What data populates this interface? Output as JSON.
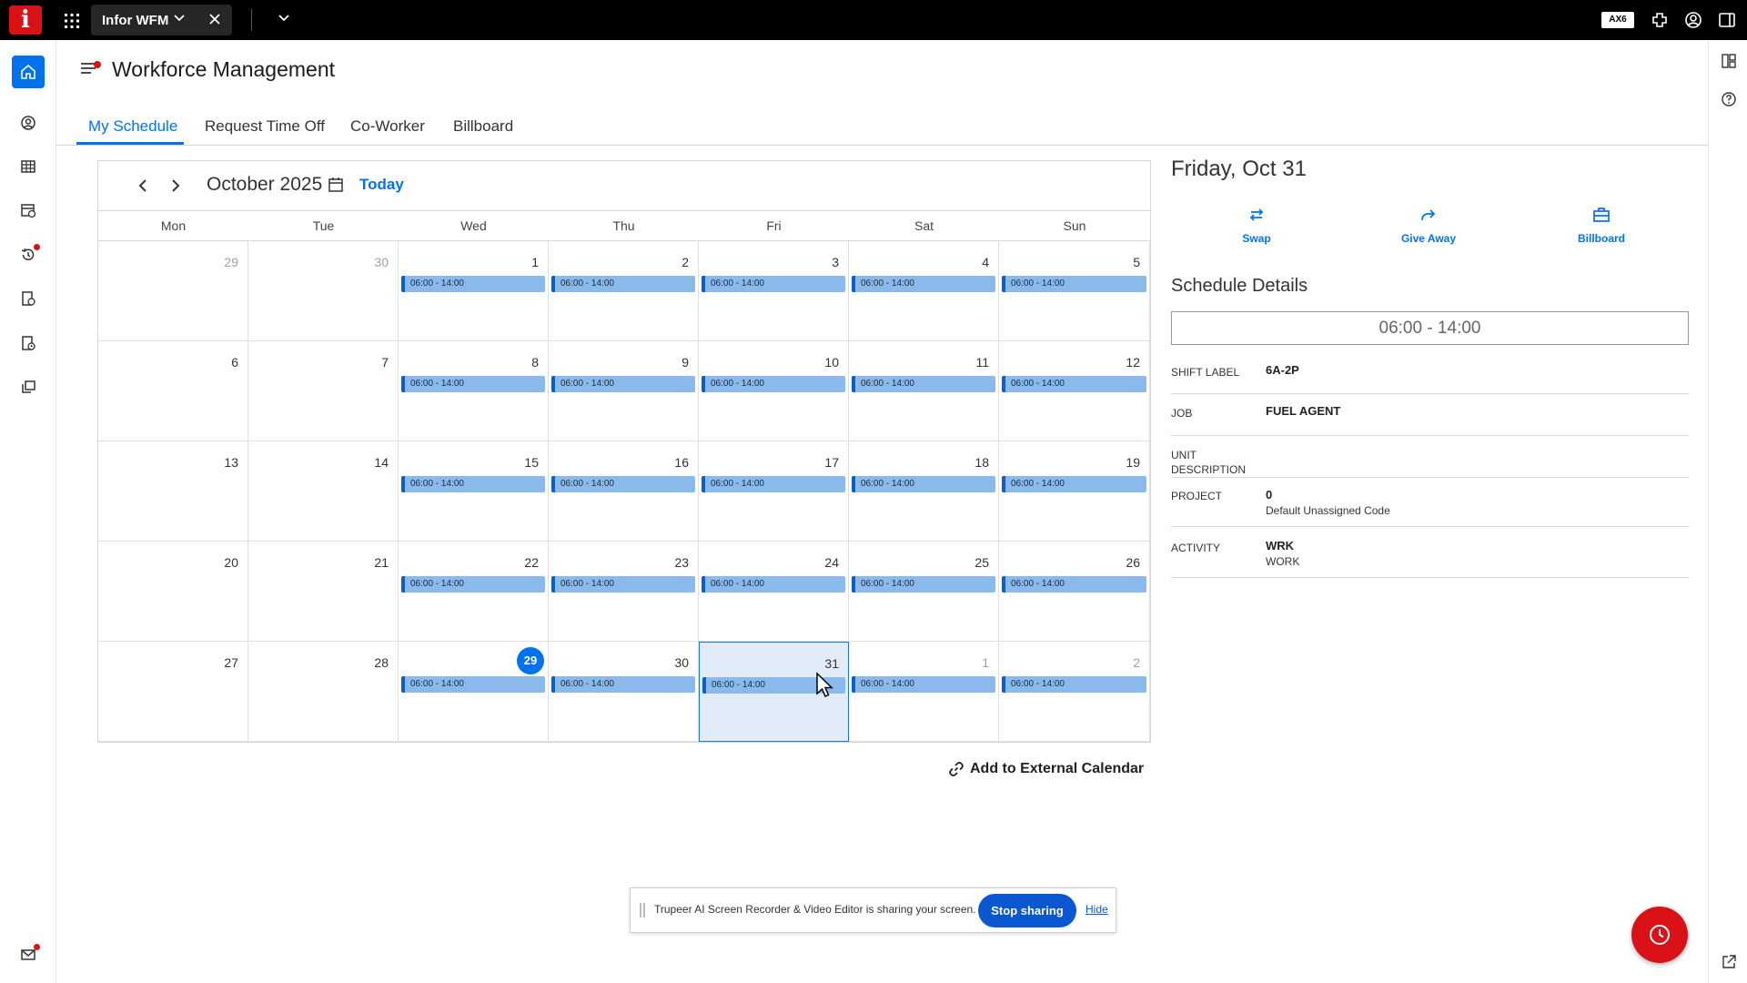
{
  "topbar": {
    "logo": "i",
    "app_tab_label": "Infor WFM",
    "env_badge": "AX6"
  },
  "leftrail": {
    "items": [
      "home-icon",
      "person-icon",
      "table-icon",
      "calendar-schedule-icon",
      "history-icon",
      "clock-doc-icon",
      "timecard-icon",
      "copy-icon",
      "mail-icon"
    ]
  },
  "header": {
    "title": "Workforce Management",
    "tabs": [
      {
        "label": "My Schedule",
        "active": true
      },
      {
        "label": "Request Time Off"
      },
      {
        "label": "Co-Worker"
      },
      {
        "label": "Billboard"
      }
    ]
  },
  "calendar": {
    "month_label": "October 2025",
    "today_label": "Today",
    "weekdays": [
      "Mon",
      "Tue",
      "Wed",
      "Thu",
      "Fri",
      "Sat",
      "Sun"
    ],
    "weeks": [
      [
        {
          "d": "29",
          "m": true
        },
        {
          "d": "30",
          "m": true
        },
        {
          "d": "1",
          "s": "06:00 - 14:00"
        },
        {
          "d": "2",
          "s": "06:00 - 14:00"
        },
        {
          "d": "3",
          "s": "06:00 - 14:00"
        },
        {
          "d": "4",
          "s": "06:00 - 14:00"
        },
        {
          "d": "5",
          "s": "06:00 - 14:00"
        }
      ],
      [
        {
          "d": "6"
        },
        {
          "d": "7"
        },
        {
          "d": "8",
          "s": "06:00 - 14:00"
        },
        {
          "d": "9",
          "s": "06:00 - 14:00"
        },
        {
          "d": "10",
          "s": "06:00 - 14:00"
        },
        {
          "d": "11",
          "s": "06:00 - 14:00"
        },
        {
          "d": "12",
          "s": "06:00 - 14:00"
        }
      ],
      [
        {
          "d": "13"
        },
        {
          "d": "14"
        },
        {
          "d": "15",
          "s": "06:00 - 14:00"
        },
        {
          "d": "16",
          "s": "06:00 - 14:00"
        },
        {
          "d": "17",
          "s": "06:00 - 14:00"
        },
        {
          "d": "18",
          "s": "06:00 - 14:00"
        },
        {
          "d": "19",
          "s": "06:00 - 14:00"
        }
      ],
      [
        {
          "d": "20"
        },
        {
          "d": "21"
        },
        {
          "d": "22",
          "s": "06:00 - 14:00"
        },
        {
          "d": "23",
          "s": "06:00 - 14:00"
        },
        {
          "d": "24",
          "s": "06:00 - 14:00"
        },
        {
          "d": "25",
          "s": "06:00 - 14:00"
        },
        {
          "d": "26",
          "s": "06:00 - 14:00"
        }
      ],
      [
        {
          "d": "27"
        },
        {
          "d": "28"
        },
        {
          "d": "29",
          "s": "06:00 - 14:00",
          "today": true
        },
        {
          "d": "30",
          "s": "06:00 - 14:00"
        },
        {
          "d": "31",
          "s": "06:00 - 14:00",
          "selected": true
        },
        {
          "d": "1",
          "s": "06:00 - 14:00",
          "m": true
        },
        {
          "d": "2",
          "s": "06:00 - 14:00",
          "m": true
        }
      ]
    ],
    "external_calendar_label": "Add to External Calendar"
  },
  "detail": {
    "date_title": "Friday, Oct 31",
    "actions": [
      {
        "label": "Swap",
        "icon": "swap-icon"
      },
      {
        "label": "Give Away",
        "icon": "share-arrow-icon"
      },
      {
        "label": "Billboard",
        "icon": "billboard-icon"
      }
    ],
    "section_title": "Schedule Details",
    "time_range": "06:00 - 14:00",
    "rows": {
      "shift_label": {
        "label": "SHIFT LABEL",
        "value": "6A-2P"
      },
      "job": {
        "label": "JOB",
        "value": "FUEL AGENT"
      },
      "unit": {
        "label": "UNIT DESCRIPTION",
        "value": ""
      },
      "project": {
        "label": "PROJECT",
        "value": "0",
        "sub": "Default Unassigned Code"
      },
      "activity": {
        "label": "ACTIVITY",
        "value": "WRK",
        "sub": "WORK"
      }
    }
  },
  "share_bar": {
    "text": "Trupeer AI Screen Recorder & Video Editor is sharing your screen.",
    "stop_label": "Stop sharing",
    "hide_label": "Hide"
  },
  "colors": {
    "accent": "#0072ed",
    "brand_red": "#da1217",
    "shift_fill": "#8ab9ec",
    "selected_cell": "#e1ecf8"
  }
}
